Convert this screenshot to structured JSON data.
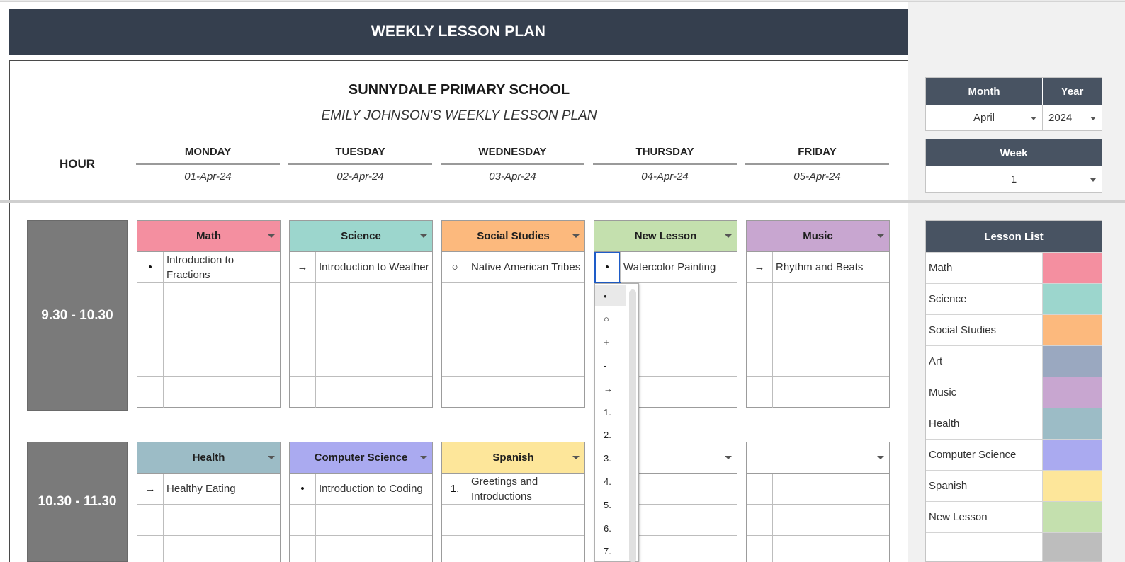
{
  "title": "WEEKLY LESSON PLAN",
  "school": "SUNNYDALE PRIMARY SCHOOL",
  "plan_title": "EMILY JOHNSON'S WEEKLY LESSON PLAN",
  "hour_label": "HOUR",
  "days": [
    {
      "name": "MONDAY",
      "date": "01-Apr-24"
    },
    {
      "name": "TUESDAY",
      "date": "02-Apr-24"
    },
    {
      "name": "WEDNESDAY",
      "date": "03-Apr-24"
    },
    {
      "name": "THURSDAY",
      "date": "04-Apr-24"
    },
    {
      "name": "FRIDAY",
      "date": "05-Apr-24"
    }
  ],
  "hours": [
    "9.30 - 10.30",
    "10.30 - 11.30"
  ],
  "row1": [
    {
      "subject": "Math",
      "color": "#f48fa0",
      "bullet": "•",
      "text": "Introduction to Fractions"
    },
    {
      "subject": "Science",
      "color": "#9cd6cd",
      "bullet": "→",
      "text": "Introduction to Weather"
    },
    {
      "subject": "Social Studies",
      "color": "#fcb97d",
      "bullet": "○",
      "text": "Native American Tribes"
    },
    {
      "subject": "New Lesson",
      "color": "#c4e0ae",
      "bullet": "•",
      "text": "Watercolor Painting"
    },
    {
      "subject": "Music",
      "color": "#c8a6d0",
      "bullet": "→",
      "text": "Rhythm and Beats"
    }
  ],
  "row2": [
    {
      "subject": "Health",
      "color": "#9cbcc6",
      "bullet": "→",
      "text": "Healthy Eating"
    },
    {
      "subject": "Computer Science",
      "color": "#aaaaf0",
      "bullet": "•",
      "text": "Introduction to Coding"
    },
    {
      "subject": "Spanish",
      "color": "#fde69a",
      "bullet": "1.",
      "text": "Greetings and Introductions"
    },
    {
      "subject": "",
      "color": "#ffffff",
      "bullet": "",
      "text": ""
    },
    {
      "subject": "",
      "color": "#ffffff",
      "bullet": "",
      "text": ""
    }
  ],
  "bullet_dropdown": {
    "options": [
      "•",
      "○",
      "+",
      "-",
      "→",
      "1.",
      "2.",
      "3.",
      "4.",
      "5.",
      "6.",
      "7."
    ],
    "active_index": 0
  },
  "month_year": {
    "month_label": "Month",
    "year_label": "Year",
    "month_value": "April",
    "year_value": "2024"
  },
  "week": {
    "label": "Week",
    "value": "1"
  },
  "lesson_list": {
    "header": "Lesson List",
    "items": [
      {
        "name": "Math",
        "color": "#f48fa0"
      },
      {
        "name": "Science",
        "color": "#9cd6cd"
      },
      {
        "name": "Social Studies",
        "color": "#fcb97d"
      },
      {
        "name": "Art",
        "color": "#9aa8c0"
      },
      {
        "name": "Music",
        "color": "#c8a6d0"
      },
      {
        "name": "Health",
        "color": "#9cbcc6"
      },
      {
        "name": "Computer Science",
        "color": "#aaaaf0"
      },
      {
        "name": "Spanish",
        "color": "#fde69a"
      },
      {
        "name": "New Lesson",
        "color": "#c4e0ae"
      },
      {
        "name": "",
        "color": "#bdbdbd"
      }
    ]
  }
}
